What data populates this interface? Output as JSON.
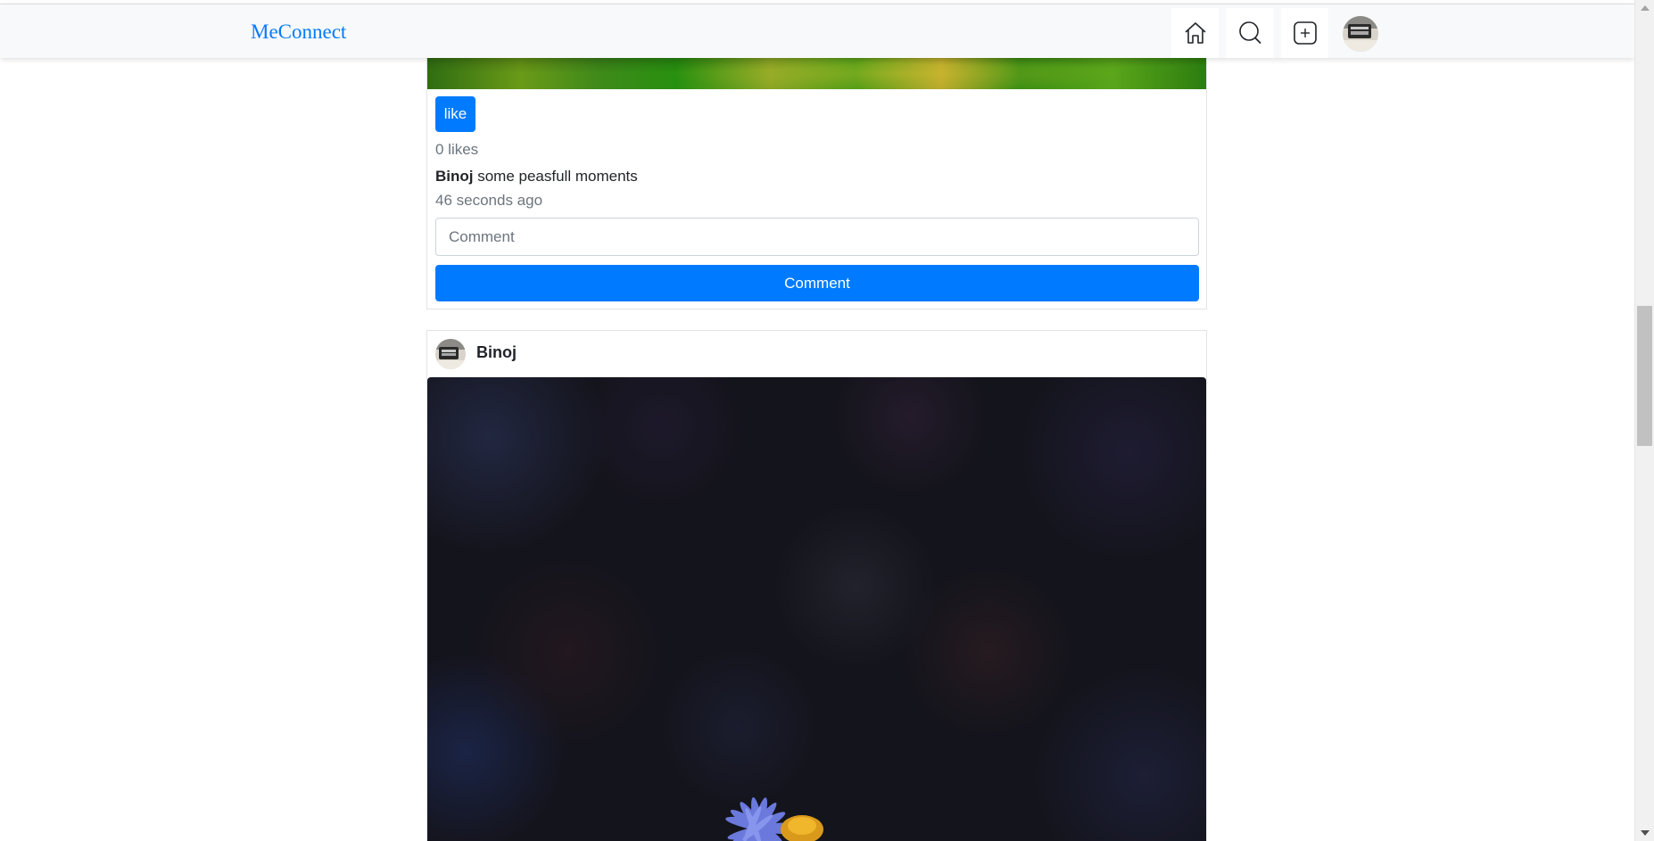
{
  "navbar": {
    "brand": "MeConnect",
    "icons": [
      "home-icon",
      "search-icon",
      "add-post-icon",
      "profile-avatar"
    ]
  },
  "posts": [
    {
      "like_label": "like",
      "likes_text": "0 likes",
      "author": "Binoj",
      "caption": " some peasfull moments",
      "time_ago": "46 seconds ago",
      "comment_placeholder": "Comment",
      "comment_button": "Comment"
    },
    {
      "author": "Binoj"
    }
  ],
  "colors": {
    "brand": "#007bff",
    "primary_button": "#007bff",
    "navbar_bg": "#f8f9fa",
    "muted_text": "#6c757d"
  }
}
